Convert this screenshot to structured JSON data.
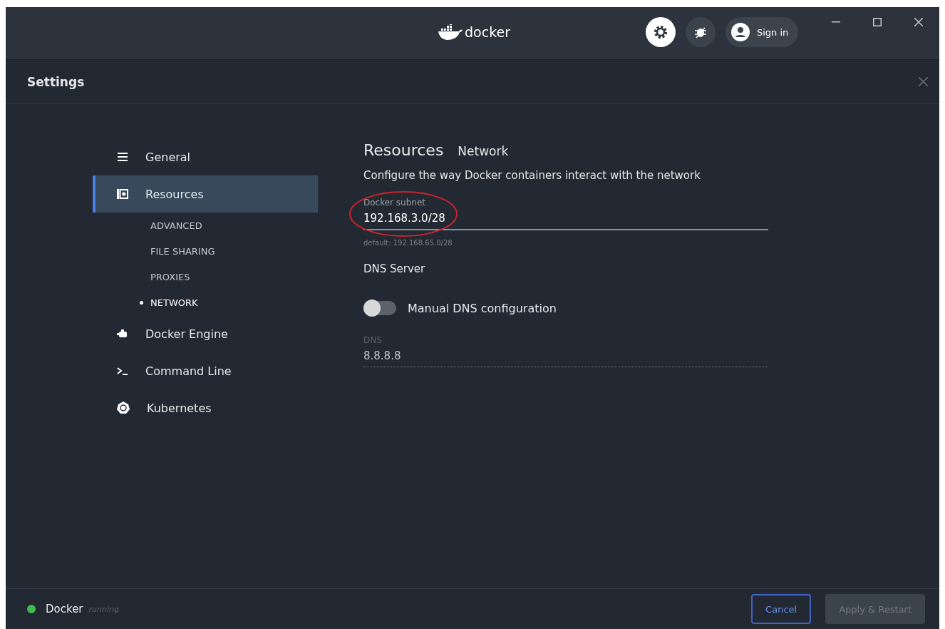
{
  "titlebar": {
    "logo_text": "docker",
    "sign_in": "Sign in",
    "settings_active": true
  },
  "settings": {
    "title": "Settings"
  },
  "sidebar": {
    "items": [
      {
        "label": "General",
        "selected": false
      },
      {
        "label": "Resources",
        "selected": true,
        "children": [
          {
            "label": "ADVANCED",
            "selected": false
          },
          {
            "label": "FILE SHARING",
            "selected": false
          },
          {
            "label": "PROXIES",
            "selected": false
          },
          {
            "label": "NETWORK",
            "selected": true
          }
        ]
      },
      {
        "label": "Docker Engine",
        "selected": false
      },
      {
        "label": "Command Line",
        "selected": false
      },
      {
        "label": "Kubernetes",
        "selected": false
      }
    ]
  },
  "content": {
    "title": "Resources",
    "subtitle": "Network",
    "description": "Configure the way Docker containers interact with the network",
    "subnet": {
      "label": "Docker subnet",
      "value": "192.168.3.0/28",
      "hint": "default: 192.168.65.0/28"
    },
    "dns_section": "DNS Server",
    "toggle": {
      "label": "Manual DNS configuration",
      "on": false
    },
    "dns": {
      "label": "DNS",
      "value": "8.8.8.8",
      "disabled": true
    }
  },
  "status_bar": {
    "name": "Docker",
    "state": "running",
    "color": "#3fb950"
  },
  "buttons": [
    {
      "label": "Cancel",
      "disabled": false,
      "primary": false
    },
    {
      "label": "Apply & Restart",
      "disabled": true,
      "primary": true
    }
  ]
}
